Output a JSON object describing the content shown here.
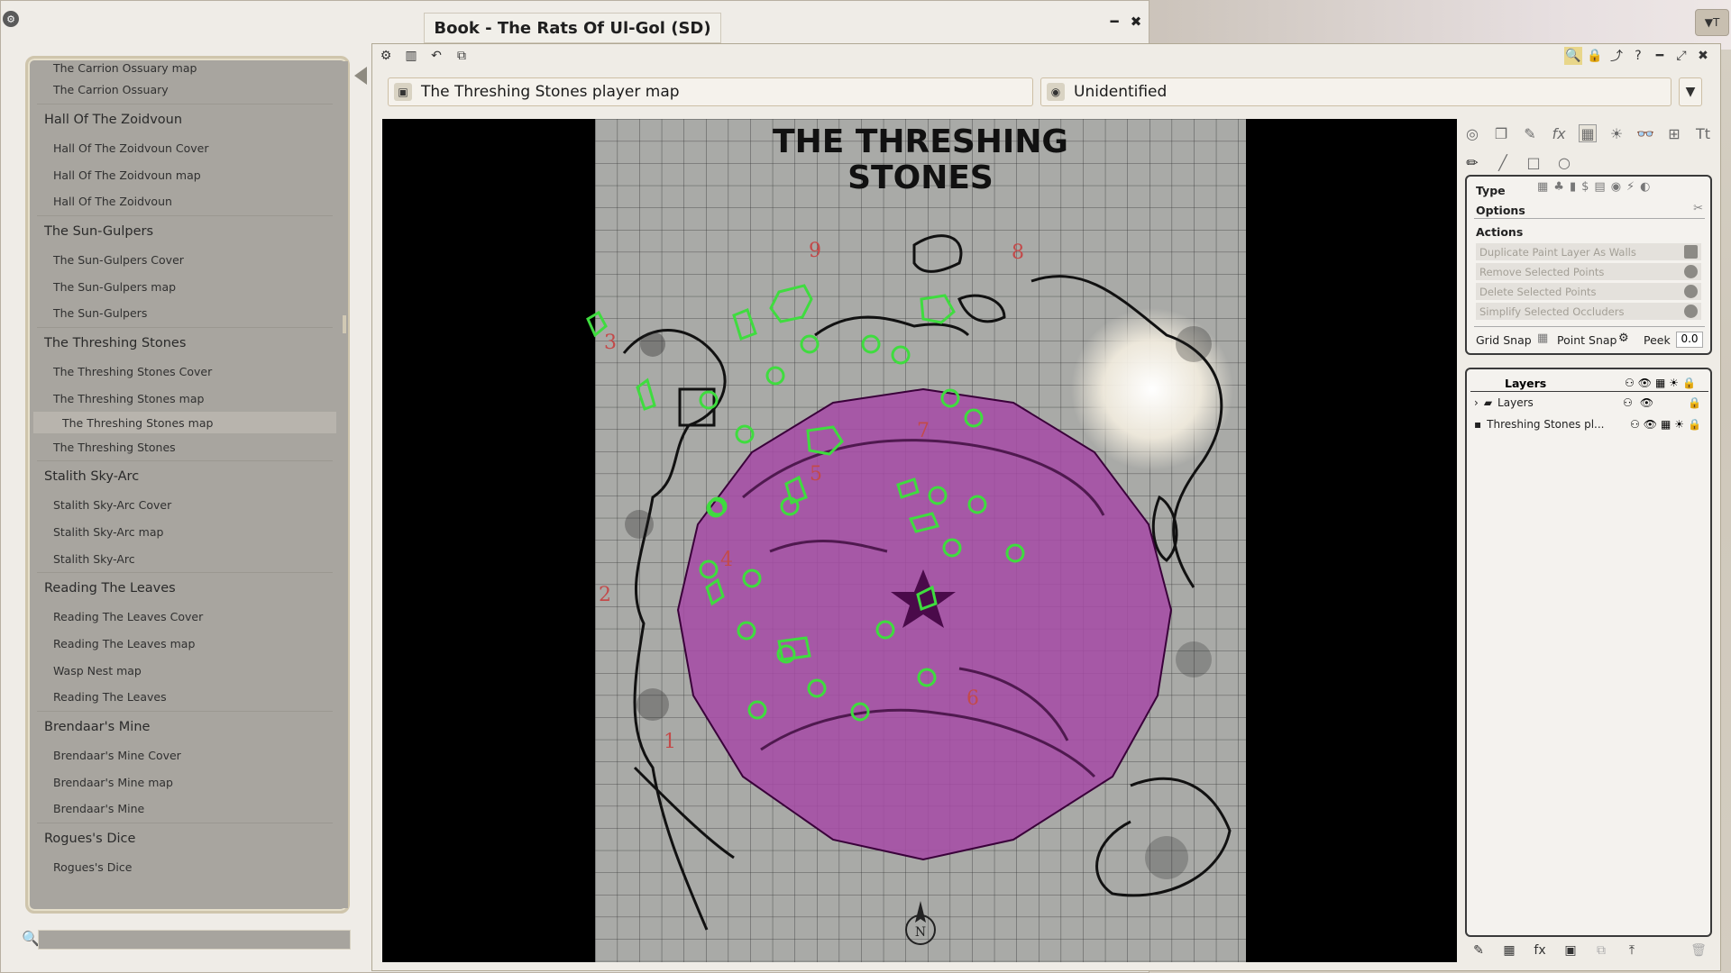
{
  "book_window": {
    "title": "Book - The Rats Of Ul-Gol (SD)",
    "minimize_glyph": "━",
    "close_glyph": "✖"
  },
  "sidebar": {
    "items": [
      {
        "kind": "item",
        "label": "The Carrion Ossuary map"
      },
      {
        "kind": "item",
        "label": "The Carrion Ossuary"
      },
      {
        "kind": "cat",
        "label": "Hall Of The Zoidvoun"
      },
      {
        "kind": "item",
        "label": "Hall Of The Zoidvoun Cover"
      },
      {
        "kind": "item",
        "label": "Hall Of The Zoidvoun map"
      },
      {
        "kind": "item",
        "label": "Hall Of The Zoidvoun"
      },
      {
        "kind": "cat",
        "label": "The Sun-Gulpers"
      },
      {
        "kind": "item",
        "label": "The Sun-Gulpers Cover"
      },
      {
        "kind": "item",
        "label": "The Sun-Gulpers map"
      },
      {
        "kind": "item",
        "label": "The Sun-Gulpers"
      },
      {
        "kind": "cat",
        "label": "The Threshing Stones"
      },
      {
        "kind": "item",
        "label": "The Threshing Stones Cover"
      },
      {
        "kind": "item",
        "label": "The Threshing Stones map"
      },
      {
        "kind": "sub",
        "label": "The Threshing Stones map"
      },
      {
        "kind": "item",
        "label": "The Threshing Stones"
      },
      {
        "kind": "cat",
        "label": "Stalith Sky-Arc"
      },
      {
        "kind": "item",
        "label": "Stalith Sky-Arc Cover"
      },
      {
        "kind": "item",
        "label": "Stalith Sky-Arc map"
      },
      {
        "kind": "item",
        "label": "Stalith Sky-Arc"
      },
      {
        "kind": "cat",
        "label": "Reading The Leaves"
      },
      {
        "kind": "item",
        "label": "Reading The Leaves Cover"
      },
      {
        "kind": "item",
        "label": "Reading The Leaves map"
      },
      {
        "kind": "item",
        "label": "Wasp Nest map"
      },
      {
        "kind": "item",
        "label": "Reading The Leaves"
      },
      {
        "kind": "cat",
        "label": "Brendaar's Mine"
      },
      {
        "kind": "item",
        "label": "Brendaar's Mine Cover"
      },
      {
        "kind": "item",
        "label": "Brendaar's Mine map"
      },
      {
        "kind": "item",
        "label": "Brendaar's Mine"
      },
      {
        "kind": "cat",
        "label": "Rogues's Dice"
      },
      {
        "kind": "item",
        "label": "Rogues's Dice"
      }
    ],
    "search_value": ""
  },
  "image_window": {
    "name": "The Threshing Stones player map",
    "nonid_name": "Unidentified"
  },
  "map": {
    "title_line1": "THE THRESHING",
    "title_line2": "STONES",
    "room_numbers": [
      "9",
      "8",
      "3",
      "7",
      "5",
      "4",
      "2",
      "6",
      "1"
    ],
    "compass_label": "N"
  },
  "tools": {
    "type_label": "Type",
    "options_label": "Options",
    "actions_label": "Actions",
    "actions": [
      "Duplicate Paint Layer As Walls",
      "Remove Selected Points",
      "Delete Selected Points",
      "Simplify Selected Occluders"
    ],
    "grid_snap_label": "Grid Snap",
    "point_snap_label": "Point Snap",
    "peek_label": "Peek",
    "peek_value": "0.0",
    "layers_title": "Layers",
    "layers": [
      {
        "name": "Layers"
      },
      {
        "name": "Threshing Stones pl..."
      }
    ]
  },
  "colors": {
    "accent_purple": "#a64aa6",
    "occluder_green": "#3fdc3f",
    "map_grid_bg": "#a9aaa7"
  }
}
